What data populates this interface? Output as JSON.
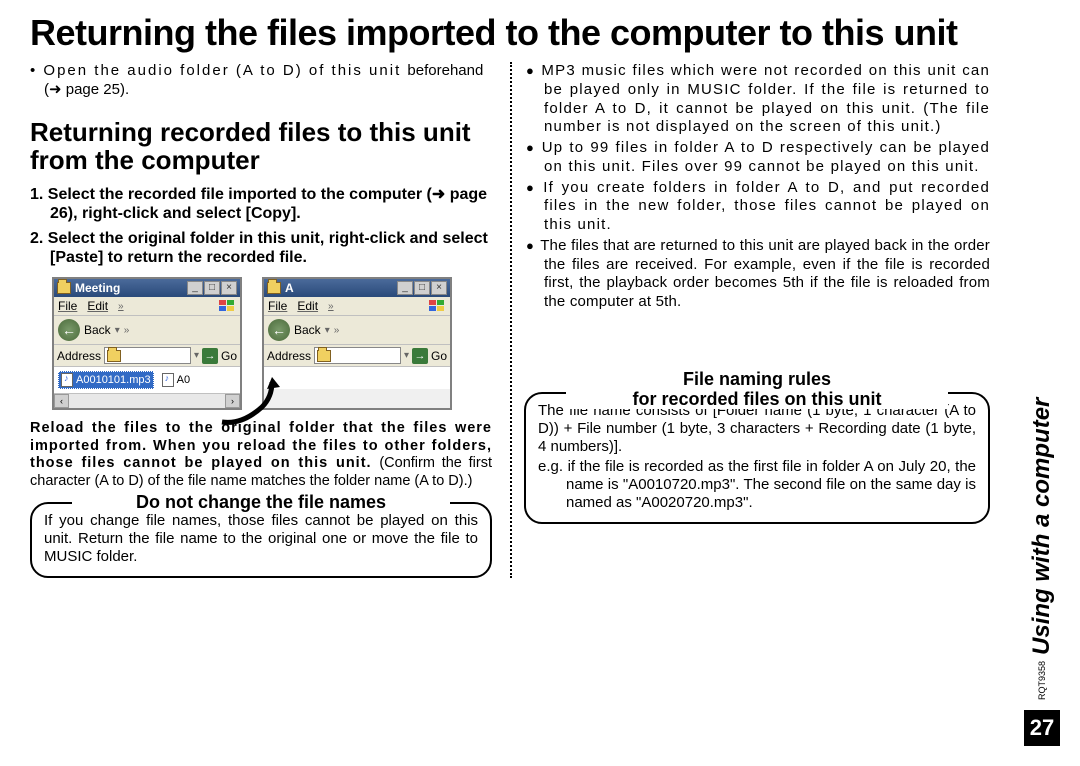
{
  "title": "Returning the files imported to the computer to this unit",
  "open_note_a": "• Open the audio folder (A to D) of this unit",
  "open_note_b": "beforehand (➜ page 25).",
  "section_heading": "Returning recorded files to this unit from the computer",
  "step1": "1. Select the recorded file imported to the computer (➜ page 26), right-click and select [Copy].",
  "step2": "2. Select the original folder in this unit, right-click and select [Paste] to return the recorded file.",
  "win1": {
    "title": "Meeting",
    "menu_file": "File",
    "menu_edit": "Edit",
    "back": "Back",
    "address": "Address",
    "go": "Go",
    "file_sel": "A0010101.mp3",
    "file2": "A0"
  },
  "win2": {
    "title": "A",
    "menu_file": "File",
    "menu_edit": "Edit",
    "back": "Back",
    "address": "Address",
    "go": "Go"
  },
  "reload_bold": "Reload the files to the original folder that the files were imported from. When you reload the files to other folders, those files cannot be played on this unit.",
  "reload_norm": "(Confirm the first character (A to D) of the file name matches the folder name (A to D).)",
  "callout1_head": "Do not change the file names",
  "callout1_body": "If you change file names, those files cannot be played on this unit. Return the file name to the original one or move the file to MUSIC folder.",
  "bullets": [
    "MP3 music files which were not recorded on this unit can be played only in MUSIC folder. If the file is returned to folder A to D, it cannot be played on this unit. (The file number is not displayed on the screen of this unit.)",
    "Up to 99 files in folder A to D respectively can be played on this unit. Files over 99 cannot be played on this unit.",
    "If you create folders in folder A to D, and put recorded files in the new folder, those files cannot be played on this unit.",
    "The files that are returned to this unit are played back in the order the files are received. For example, even if the file is recorded first, the playback order becomes 5th if the file is reloaded from the computer at 5th."
  ],
  "callout2_head_l1": "File naming rules",
  "callout2_head_l2": "for recorded files on this unit",
  "fnr_body": "The file name consists of [Folder name (1 byte, 1 character (A to D)) + File number (1 byte, 3 characters + Recording date (1 byte, 4 numbers)].",
  "eg_label": "e.g.",
  "eg_body": "if the file is recorded as the first file in folder A on July 20, the name is \"A0010720.mp3\". The second file on the same day is named as \"A0020720.mp3\".",
  "side_label": "Using with a computer",
  "page_num": "27",
  "doc_code": "RQT9358"
}
